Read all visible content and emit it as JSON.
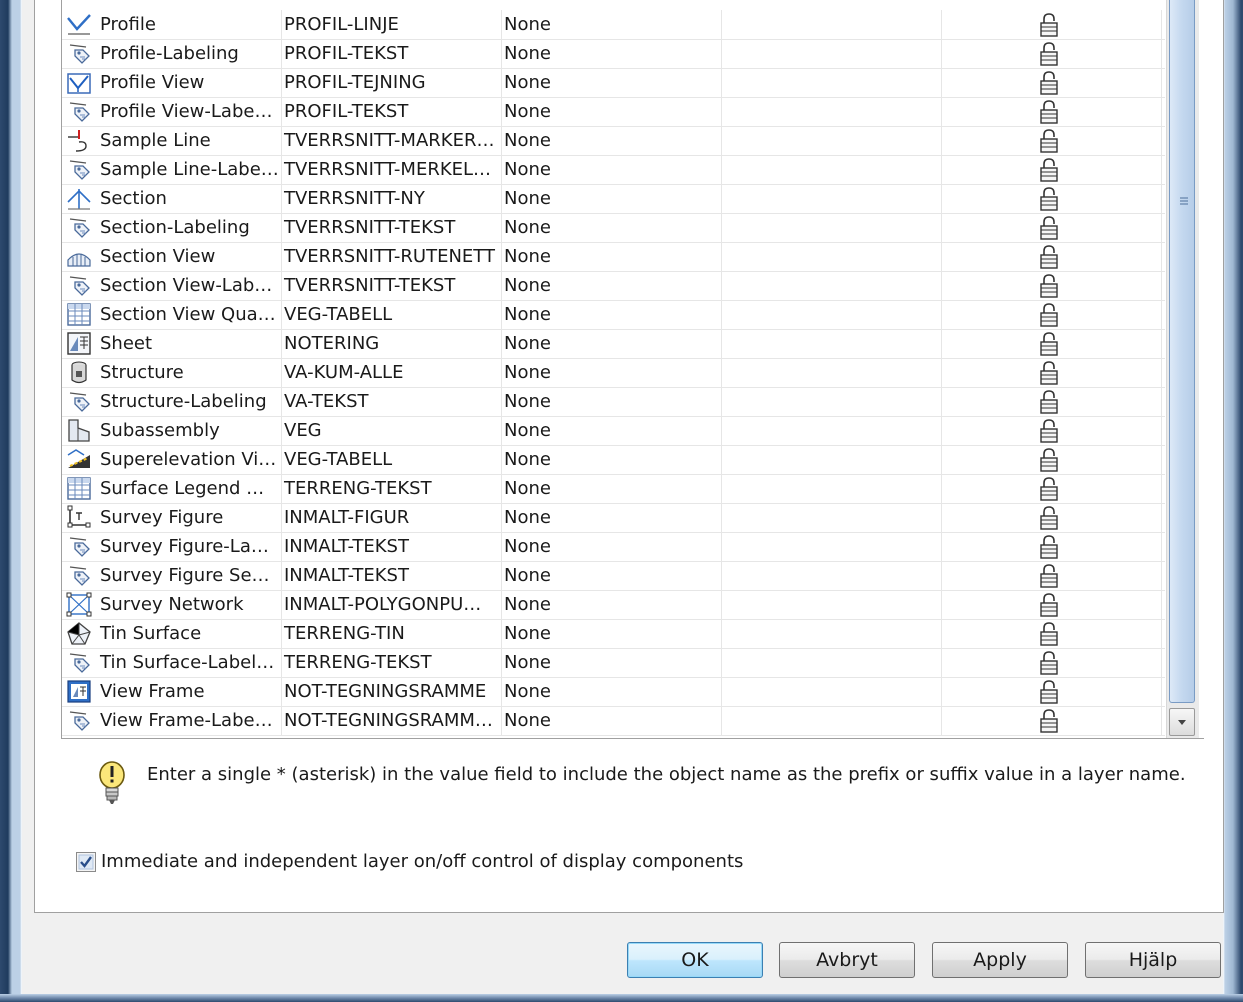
{
  "rows": [
    {
      "name": "Profile",
      "layer": "PROFIL-LINJE",
      "modifier": "None",
      "icon": "profile-icon"
    },
    {
      "name": "Profile-Labeling",
      "layer": "PROFIL-TEKST",
      "modifier": "None",
      "icon": "label-tag-icon"
    },
    {
      "name": "Profile View",
      "layer": "PROFIL-TEJNING",
      "modifier": "None",
      "icon": "profile-view-icon"
    },
    {
      "name": "Profile View-Labe…",
      "layer": "PROFIL-TEKST",
      "modifier": "None",
      "icon": "label-tag-icon"
    },
    {
      "name": "Sample Line",
      "layer": "TVERRSNITT-MARKER…",
      "modifier": "None",
      "icon": "sample-line-icon"
    },
    {
      "name": "Sample Line-Labe…",
      "layer": "TVERRSNITT-MERKEL…",
      "modifier": "None",
      "icon": "label-tag-icon"
    },
    {
      "name": "Section",
      "layer": "TVERRSNITT-NY",
      "modifier": "None",
      "icon": "section-icon"
    },
    {
      "name": "Section-Labeling",
      "layer": "TVERRSNITT-TEKST",
      "modifier": "None",
      "icon": "label-tag-icon"
    },
    {
      "name": "Section View",
      "layer": "TVERRSNITT-RUTENETT",
      "modifier": "None",
      "icon": "section-view-icon"
    },
    {
      "name": "Section View-Lab…",
      "layer": "TVERRSNITT-TEKST",
      "modifier": "None",
      "icon": "label-tag-icon"
    },
    {
      "name": "Section View Qua…",
      "layer": "VEG-TABELL",
      "modifier": "None",
      "icon": "table-icon"
    },
    {
      "name": "Sheet",
      "layer": "NOTERING",
      "modifier": "None",
      "icon": "sheet-icon"
    },
    {
      "name": "Structure",
      "layer": "VA-KUM-ALLE",
      "modifier": "None",
      "icon": "structure-icon"
    },
    {
      "name": "Structure-Labeling",
      "layer": "VA-TEKST",
      "modifier": "None",
      "icon": "label-tag-icon"
    },
    {
      "name": "Subassembly",
      "layer": "VEG",
      "modifier": "None",
      "icon": "subassembly-icon"
    },
    {
      "name": "Superelevation Vi…",
      "layer": "VEG-TABELL",
      "modifier": "None",
      "icon": "superelevation-icon"
    },
    {
      "name": "Surface Legend …",
      "layer": "TERRENG-TEKST",
      "modifier": "None",
      "icon": "table-icon"
    },
    {
      "name": "Survey Figure",
      "layer": "INMALT-FIGUR",
      "modifier": "None",
      "icon": "survey-figure-icon"
    },
    {
      "name": "Survey Figure-La…",
      "layer": "INMALT-TEKST",
      "modifier": "None",
      "icon": "label-tag-icon"
    },
    {
      "name": "Survey Figure Se…",
      "layer": "INMALT-TEKST",
      "modifier": "None",
      "icon": "label-tag-icon"
    },
    {
      "name": "Survey Network",
      "layer": "INMALT-POLYGONPU…",
      "modifier": "None",
      "icon": "survey-network-icon"
    },
    {
      "name": "Tin Surface",
      "layer": "TERRENG-TIN",
      "modifier": "None",
      "icon": "tin-surface-icon"
    },
    {
      "name": "Tin Surface-Label…",
      "layer": "TERRENG-TEKST",
      "modifier": "None",
      "icon": "label-tag-icon"
    },
    {
      "name": "View Frame",
      "layer": "NOT-TEGNINGSRAMME",
      "modifier": "None",
      "icon": "view-frame-icon"
    },
    {
      "name": "View Frame-Labe…",
      "layer": "NOT-TEGNINGSRAMM…",
      "modifier": "None",
      "icon": "label-tag-icon"
    }
  ],
  "hint": {
    "text": "Enter a single * (asterisk) in the value field to include the object name as the prefix or suffix value in a layer name.",
    "icon": "lightbulb-icon"
  },
  "option": {
    "label": "Immediate and independent layer on/off control of display components",
    "checked": true
  },
  "buttons": {
    "ok": "OK",
    "cancel": "Avbryt",
    "apply": "Apply",
    "help": "Hjälp"
  },
  "lock_icon": "lock-icon"
}
